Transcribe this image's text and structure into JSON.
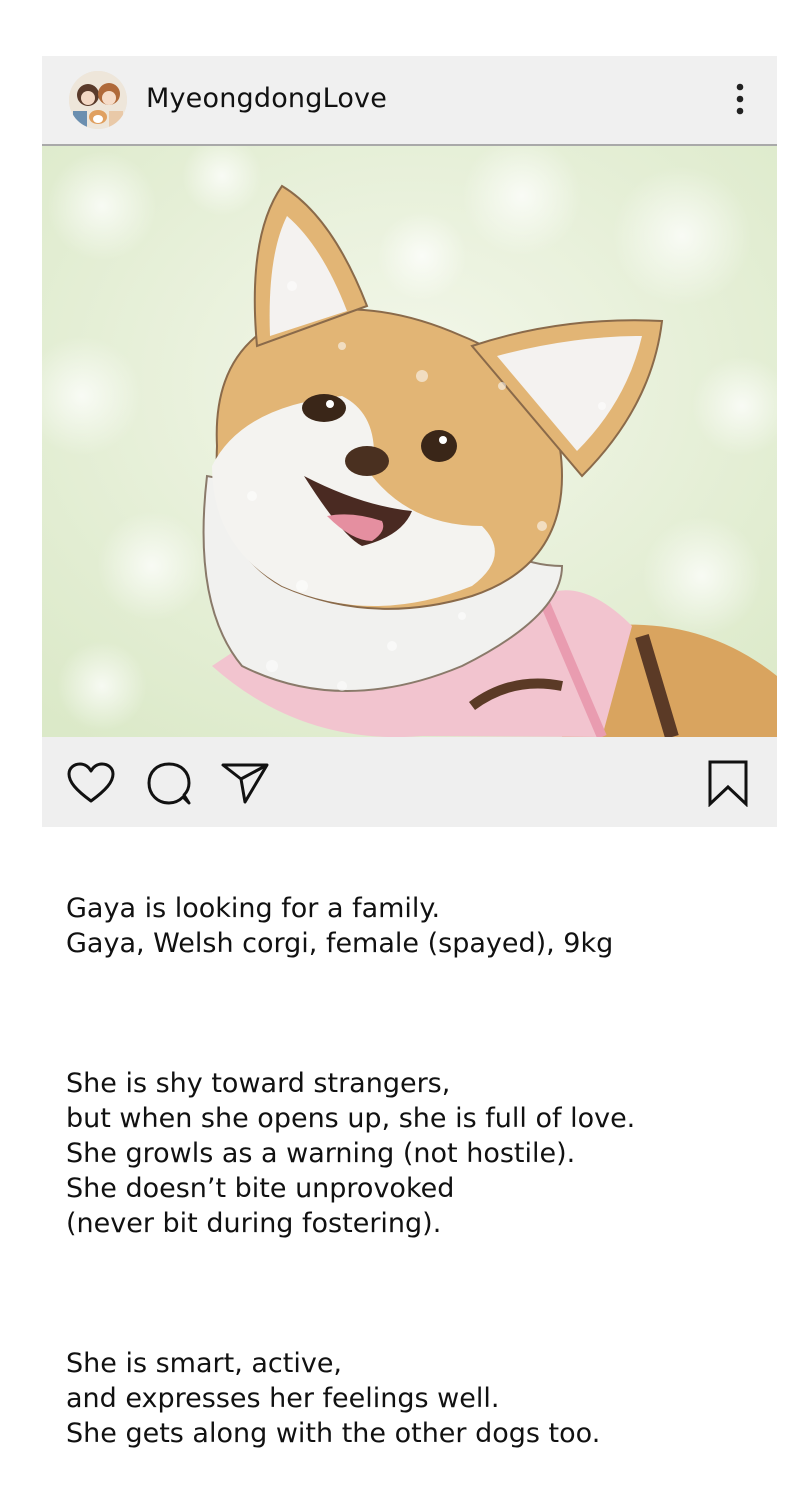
{
  "post": {
    "username": "MyeongdongLove",
    "avatar_icon": "avatar-couple-with-dog",
    "more_icon": "more-vertical-icon",
    "image": {
      "subject": "corgi-in-pink-harness-illustration",
      "background_color": "#e4efd6"
    },
    "actions": {
      "like_icon": "heart-icon",
      "comment_icon": "comment-bubble-icon",
      "share_icon": "paper-plane-icon",
      "save_icon": "bookmark-icon"
    },
    "caption": {
      "paragraphs": [
        "Gaya is looking for a family.\nGaya, Welsh corgi, female (spayed), 9kg",
        "She is shy toward strangers,\nbut when she opens up, she is full of love.\nShe growls as a warning (not hostile).\nShe doesn’t bite unprovoked\n(never bit during fostering).",
        "She is smart, active,\nand expresses her feelings well.\nShe gets along with the other dogs too."
      ]
    }
  }
}
